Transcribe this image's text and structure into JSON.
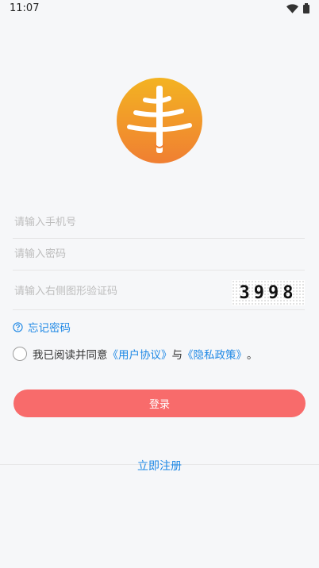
{
  "status_bar": {
    "time": "11:07"
  },
  "form": {
    "phone_placeholder": "请输入手机号",
    "password_placeholder": "请输入密码",
    "captcha_placeholder": "请输入右侧图形验证码",
    "captcha_code": "3998"
  },
  "forgot_password": "忘记密码",
  "agreement": {
    "prefix": "我已阅读并同意",
    "user_agreement": "《用户协议》",
    "and": "与",
    "privacy_policy": "《隐私政策》",
    "suffix": "。"
  },
  "login_button": "登录",
  "register_link": "立即注册",
  "colors": {
    "accent": "#1e88e5",
    "login": "#f86b6b",
    "logo_top": "#f3b322",
    "logo_bottom": "#f07f32"
  }
}
